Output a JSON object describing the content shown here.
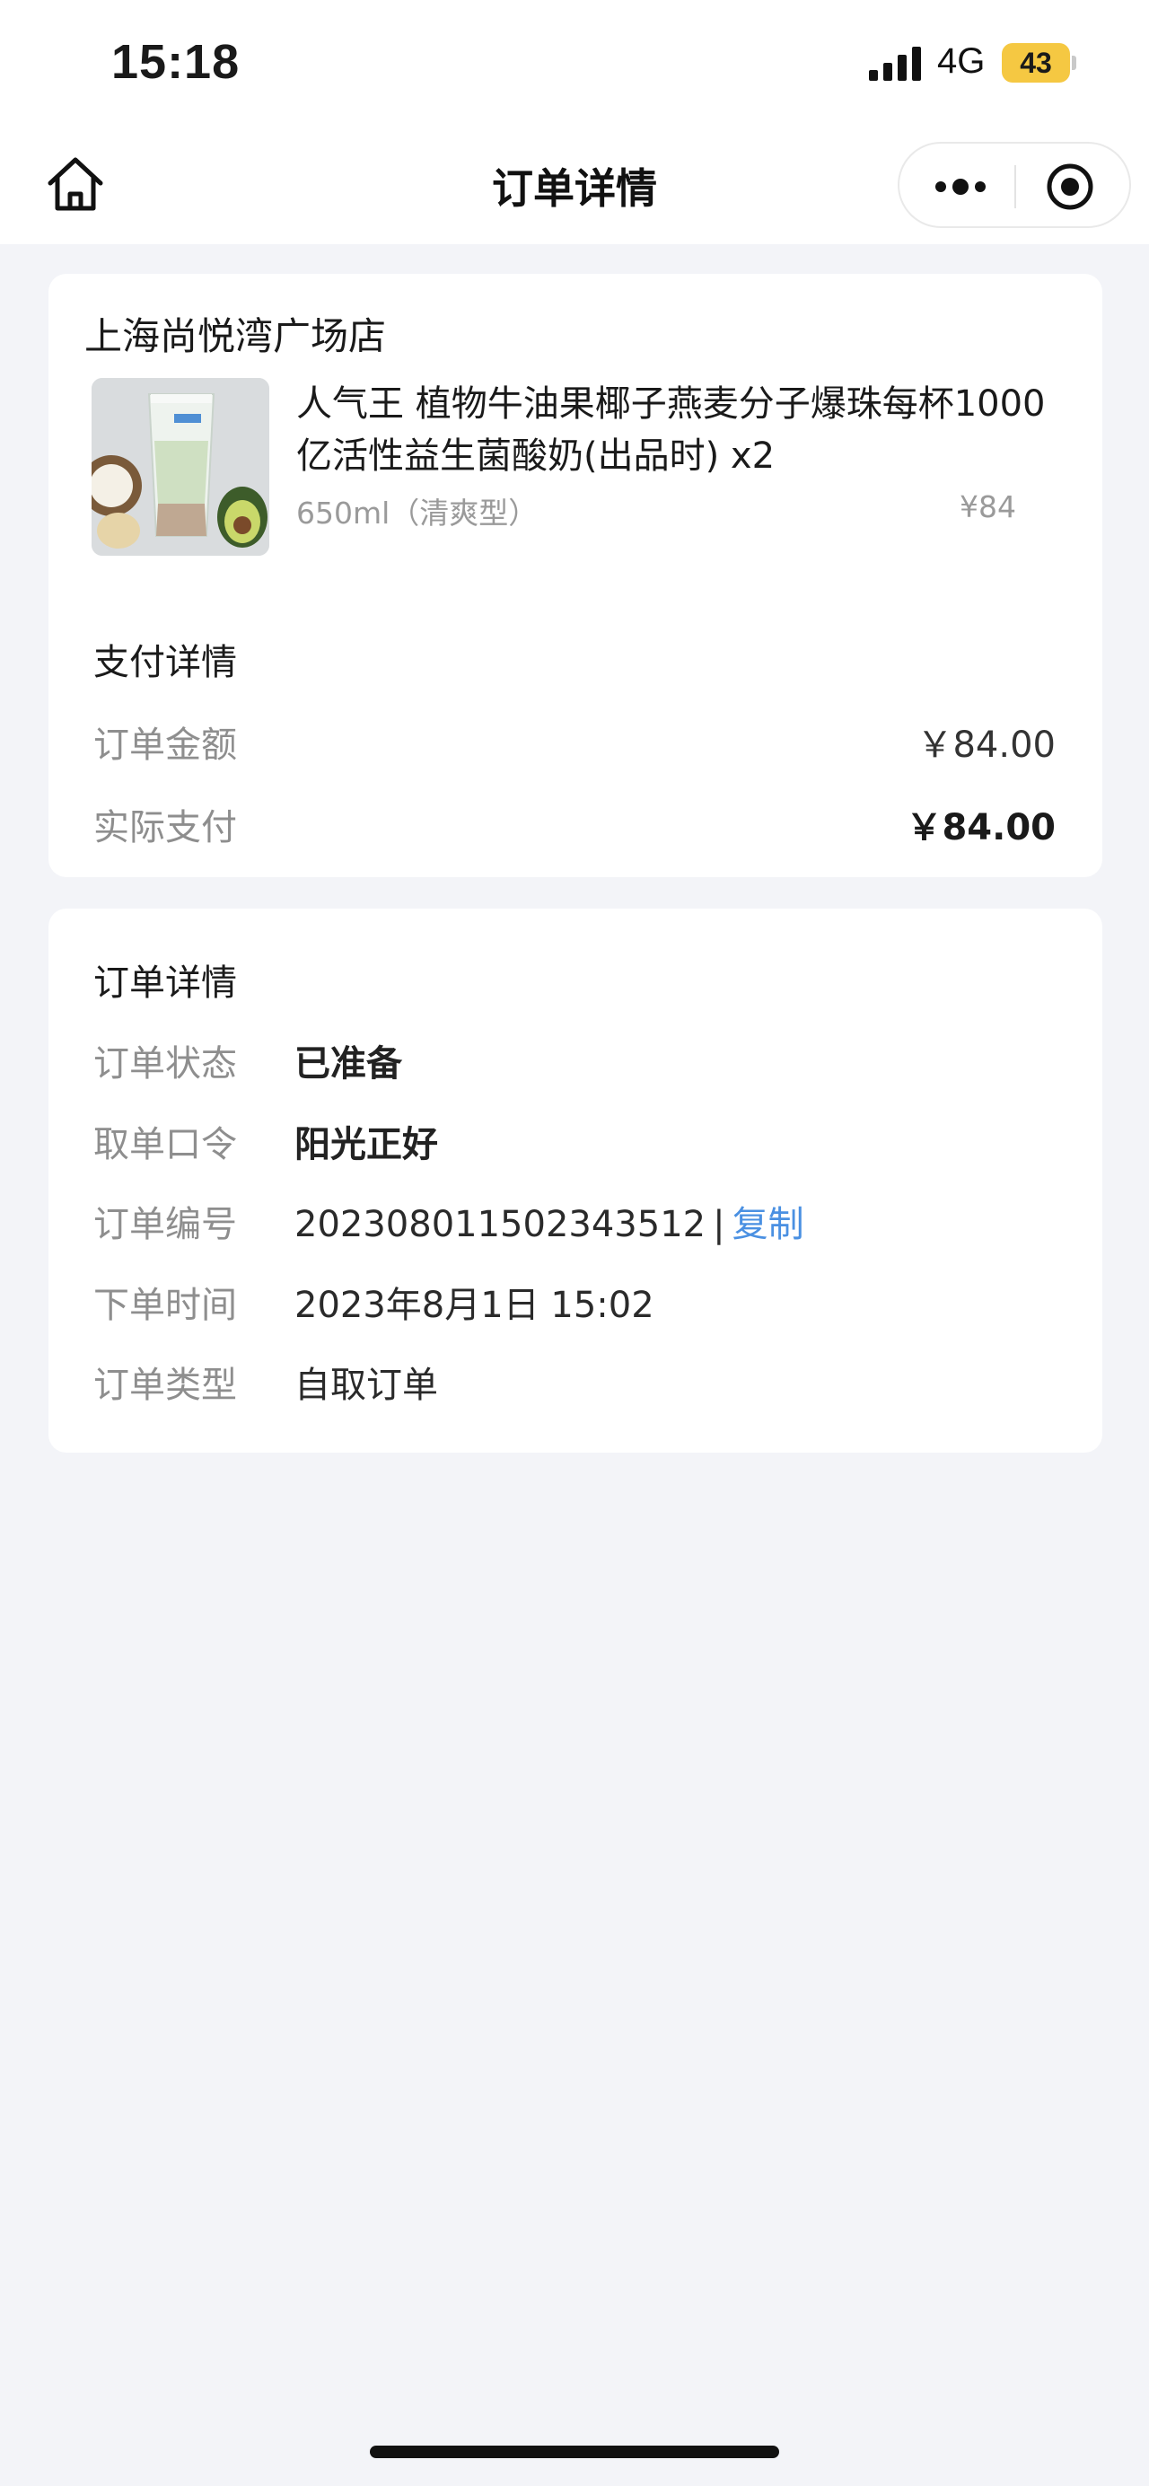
{
  "status_bar": {
    "time": "15:18",
    "network": "4G",
    "battery": "43",
    "icons": [
      "signal-icon",
      "battery-icon"
    ]
  },
  "nav": {
    "title": "订单详情",
    "icons": [
      "home-icon",
      "more-icon",
      "target-icon"
    ]
  },
  "order_card": {
    "store_name": "上海尚悦湾广场店",
    "product": {
      "name": "人气王 植物牛油果椰子燕麦分子爆珠每杯1000亿活性益生菌酸奶(出品时) x2",
      "spec": "650ml（清爽型）",
      "price": "¥84"
    },
    "payment": {
      "title": "支付详情",
      "order_amount_label": "订单金额",
      "order_amount_value": "￥84.00",
      "actual_paid_label": "实际支付",
      "actual_paid_value": "￥84.00"
    }
  },
  "details_card": {
    "title": "订单详情",
    "rows": [
      {
        "label": "订单状态",
        "value": "已准备"
      },
      {
        "label": "取单口令",
        "value": "阳光正好"
      },
      {
        "label": "订单编号",
        "value": "20230801150234351 2"
      },
      {
        "label": "下单时间",
        "value": "2023年8月1日 15:02"
      },
      {
        "label": "订单类型",
        "value": "自取订单"
      }
    ],
    "order_number": "202308011502343512",
    "copy_separator": "|",
    "copy_label": "复制"
  },
  "colors": {
    "background": "#f3f4f8",
    "card": "#ffffff",
    "link": "#4a90e2",
    "battery": "#f5c842"
  }
}
